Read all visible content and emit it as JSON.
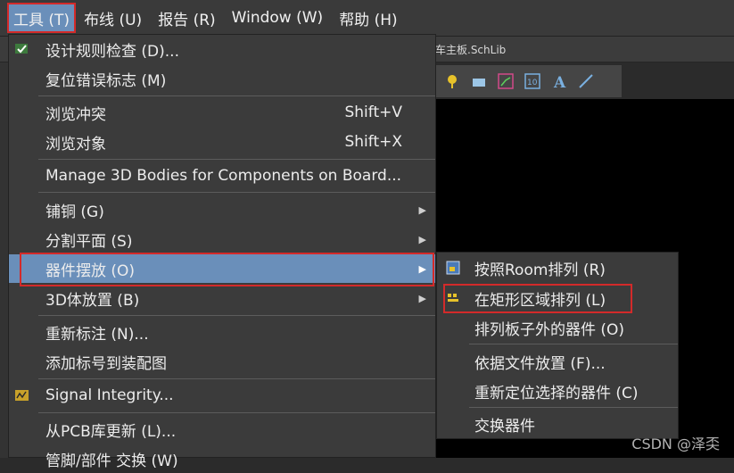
{
  "menubar": {
    "items": [
      {
        "label": "工具 (T)"
      },
      {
        "label": "布线 (U)"
      },
      {
        "label": "报告 (R)"
      },
      {
        "label": "Window (W)"
      },
      {
        "label": "帮助 (H)"
      }
    ]
  },
  "tab": {
    "label": "车主板.SchLib"
  },
  "menu": {
    "items": [
      {
        "label": "设计规则检查 (D)...",
        "icon": "design-rule-check-icon"
      },
      {
        "label": "复位错误标志 (M)"
      },
      {
        "label": "浏览冲突",
        "shortcut": "Shift+V"
      },
      {
        "label": "浏览对象",
        "shortcut": "Shift+X"
      },
      {
        "label": "Manage 3D Bodies for Components on Board..."
      },
      {
        "label": "铺铜 (G)"
      },
      {
        "label": "分割平面 (S)"
      },
      {
        "label": "器件摆放 (O)"
      },
      {
        "label": "3D体放置 (B)"
      },
      {
        "label": "重新标注 (N)..."
      },
      {
        "label": "添加标号到装配图"
      },
      {
        "label": "Signal Integrity...",
        "icon": "signal-integrity-icon"
      },
      {
        "label": "从PCB库更新 (L)..."
      },
      {
        "label": "管脚/部件 交换 (W)"
      }
    ]
  },
  "submenu": {
    "items": [
      {
        "label": "按照Room排列 (R)",
        "icon": "room-arrange-icon"
      },
      {
        "label": "在矩形区域排列 (L)",
        "icon": "rect-area-arrange-icon"
      },
      {
        "label": "排列板子外的器件 (O)"
      },
      {
        "label": "依据文件放置 (F)..."
      },
      {
        "label": "重新定位选择的器件 (C)"
      },
      {
        "label": "交换器件"
      }
    ]
  },
  "watermark": {
    "text": "CSDN @泽奀"
  },
  "colors": {
    "highlight": "#6a8fba",
    "annotation": "#d32a2a",
    "menu_bg": "#3b3b3b"
  }
}
